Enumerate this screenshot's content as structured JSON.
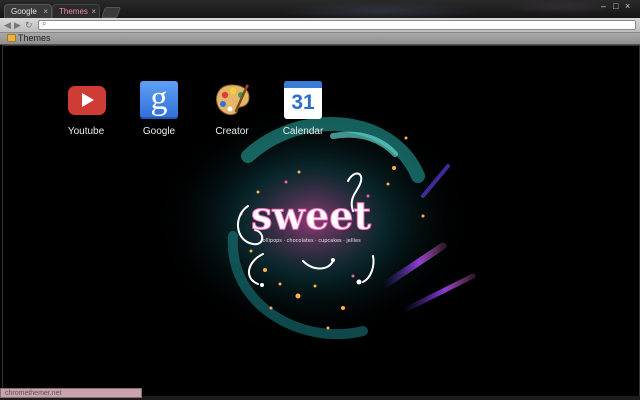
{
  "tabs": [
    {
      "title": "Google",
      "close": "×"
    },
    {
      "title": "Themes",
      "close": "×"
    }
  ],
  "window_controls": {
    "minimize": "–",
    "maximize": "□",
    "close": "×"
  },
  "bookmarks": [
    {
      "label": "Themes"
    }
  ],
  "apps": [
    {
      "label": "Youtube",
      "icon": "youtube-icon"
    },
    {
      "label": "Google",
      "icon": "google-icon",
      "glyph": "g"
    },
    {
      "label": "Creator",
      "icon": "palette-icon"
    },
    {
      "label": "Calendar",
      "icon": "calendar-icon",
      "glyph": "31"
    }
  ],
  "wallpaper": {
    "title": "sweet",
    "subtitle": "lollipops · chocolates · cupcakes · jellies"
  },
  "status": {
    "text": "chromethemer.net"
  },
  "colors": {
    "youtube": "#cf3b35",
    "google": "#3f84e5",
    "calendar": "#3a7bd5",
    "accent_teal": "#2fd0c8",
    "accent_pink": "#f08aa8"
  }
}
